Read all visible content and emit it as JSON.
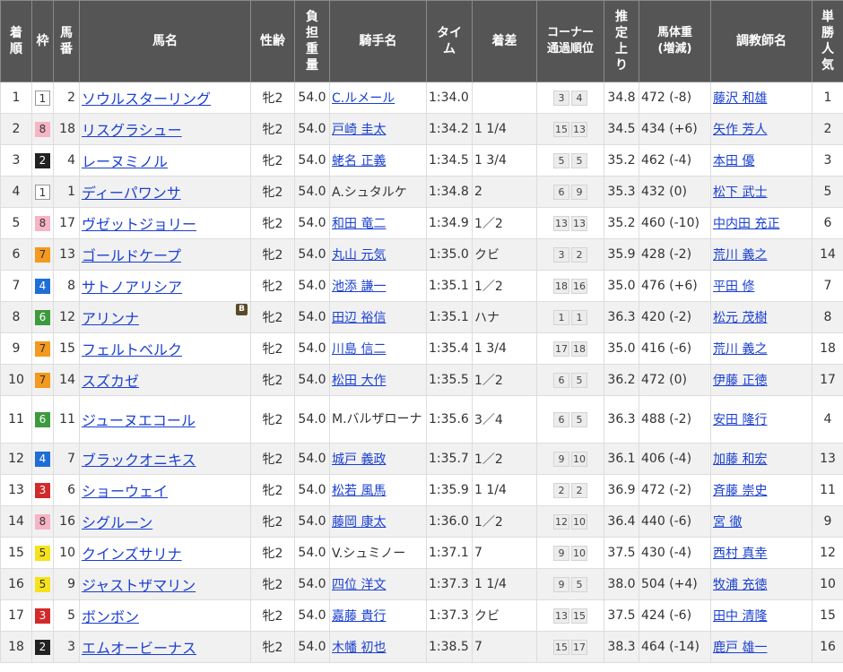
{
  "headers": [
    {
      "key": "rank",
      "label": "着\n順"
    },
    {
      "key": "waku",
      "label": "枠"
    },
    {
      "key": "umaban",
      "label": "馬\n番"
    },
    {
      "key": "horse",
      "label": "馬名"
    },
    {
      "key": "sexage",
      "label": "性齢"
    },
    {
      "key": "weight",
      "label": "負\n担\n重\n量"
    },
    {
      "key": "jockey",
      "label": "騎手名"
    },
    {
      "key": "time",
      "label": "タイ\nム"
    },
    {
      "key": "margin",
      "label": "着差"
    },
    {
      "key": "corner",
      "label": "コーナー\n通過順位"
    },
    {
      "key": "last3f",
      "label": "推\n定\n上\nり"
    },
    {
      "key": "bodyweight",
      "label": "馬体重\n(増減)"
    },
    {
      "key": "trainer",
      "label": "調教師名"
    },
    {
      "key": "pop",
      "label": "単\n勝\n人\n気"
    }
  ],
  "rows": [
    {
      "rank": "1",
      "waku": "1",
      "umaban": "2",
      "horse": "ソウルスターリング",
      "sexage": "牝2",
      "weight": "54.0",
      "jockey": "C.ルメール",
      "jockey_link": true,
      "time": "1:34.0",
      "margin": "",
      "corner": [
        "3",
        "4"
      ],
      "last3f": "34.8",
      "bodyweight": "472 (-8)",
      "trainer": "藤沢 和雄",
      "pop": "1"
    },
    {
      "rank": "2",
      "waku": "8",
      "umaban": "18",
      "horse": "リスグラシュー",
      "sexage": "牝2",
      "weight": "54.0",
      "jockey": "戸崎 圭太",
      "jockey_link": true,
      "time": "1:34.2",
      "margin": "1 1/4",
      "corner": [
        "15",
        "13"
      ],
      "last3f": "34.5",
      "bodyweight": "434 (+6)",
      "trainer": "矢作 芳人",
      "pop": "2"
    },
    {
      "rank": "3",
      "waku": "2",
      "umaban": "4",
      "horse": "レーヌミノル",
      "sexage": "牝2",
      "weight": "54.0",
      "jockey": "蛯名 正義",
      "jockey_link": true,
      "time": "1:34.5",
      "margin": "1 3/4",
      "corner": [
        "5",
        "5"
      ],
      "last3f": "35.2",
      "bodyweight": "462 (-4)",
      "trainer": "本田 優",
      "pop": "3"
    },
    {
      "rank": "4",
      "waku": "1",
      "umaban": "1",
      "horse": "ディーパワンサ",
      "sexage": "牝2",
      "weight": "54.0",
      "jockey": "A.シュタルケ",
      "jockey_link": false,
      "time": "1:34.8",
      "margin": "2",
      "corner": [
        "6",
        "9"
      ],
      "last3f": "35.3",
      "bodyweight": "432 (0)",
      "trainer": "松下 武士",
      "pop": "5"
    },
    {
      "rank": "5",
      "waku": "8",
      "umaban": "17",
      "horse": "ヴゼットジョリー",
      "sexage": "牝2",
      "weight": "54.0",
      "jockey": "和田 竜二",
      "jockey_link": true,
      "time": "1:34.9",
      "margin": "1／2",
      "corner": [
        "13",
        "13"
      ],
      "last3f": "35.2",
      "bodyweight": "460 (-10)",
      "trainer": "中内田 充正",
      "pop": "6"
    },
    {
      "rank": "6",
      "waku": "7",
      "umaban": "13",
      "horse": "ゴールドケープ",
      "sexage": "牝2",
      "weight": "54.0",
      "jockey": "丸山 元気",
      "jockey_link": true,
      "time": "1:35.0",
      "margin": "クビ",
      "corner": [
        "3",
        "2"
      ],
      "last3f": "35.9",
      "bodyweight": "428 (-2)",
      "trainer": "荒川 義之",
      "pop": "14"
    },
    {
      "rank": "7",
      "waku": "4",
      "umaban": "8",
      "horse": "サトノアリシア",
      "sexage": "牝2",
      "weight": "54.0",
      "jockey": "池添 謙一",
      "jockey_link": true,
      "time": "1:35.1",
      "margin": "1／2",
      "corner": [
        "18",
        "16"
      ],
      "last3f": "35.0",
      "bodyweight": "476 (+6)",
      "trainer": "平田 修",
      "pop": "7"
    },
    {
      "rank": "8",
      "waku": "6",
      "umaban": "12",
      "horse": "アリンナ",
      "badge": "B",
      "sexage": "牝2",
      "weight": "54.0",
      "jockey": "田辺 裕信",
      "jockey_link": true,
      "time": "1:35.1",
      "margin": "ハナ",
      "corner": [
        "1",
        "1"
      ],
      "last3f": "36.3",
      "bodyweight": "420 (-2)",
      "trainer": "松元 茂樹",
      "pop": "8"
    },
    {
      "rank": "9",
      "waku": "7",
      "umaban": "15",
      "horse": "フェルトベルク",
      "sexage": "牝2",
      "weight": "54.0",
      "jockey": "川島 信二",
      "jockey_link": true,
      "time": "1:35.4",
      "margin": "1 3/4",
      "corner": [
        "17",
        "18"
      ],
      "last3f": "35.0",
      "bodyweight": "416 (-6)",
      "trainer": "荒川 義之",
      "pop": "18"
    },
    {
      "rank": "10",
      "waku": "7",
      "umaban": "14",
      "horse": "スズカゼ",
      "sexage": "牝2",
      "weight": "54.0",
      "jockey": "松田 大作",
      "jockey_link": true,
      "time": "1:35.5",
      "margin": "1／2",
      "corner": [
        "6",
        "5"
      ],
      "last3f": "36.2",
      "bodyweight": "472 (0)",
      "trainer": "伊藤 正徳",
      "pop": "17"
    },
    {
      "rank": "11",
      "waku": "6",
      "umaban": "11",
      "horse": "ジューヌエコール",
      "sexage": "牝2",
      "weight": "54.0",
      "jockey": "M.バルザローナ",
      "jockey_link": false,
      "tall": true,
      "time": "1:35.6",
      "margin": "3／4",
      "corner": [
        "6",
        "5"
      ],
      "last3f": "36.3",
      "bodyweight": "488 (-2)",
      "trainer": "安田 隆行",
      "pop": "4"
    },
    {
      "rank": "12",
      "waku": "4",
      "umaban": "7",
      "horse": "ブラックオニキス",
      "sexage": "牝2",
      "weight": "54.0",
      "jockey": "城戸 義政",
      "jockey_link": true,
      "time": "1:35.7",
      "margin": "1／2",
      "corner": [
        "9",
        "10"
      ],
      "last3f": "36.1",
      "bodyweight": "406 (-4)",
      "trainer": "加藤 和宏",
      "pop": "13"
    },
    {
      "rank": "13",
      "waku": "3",
      "umaban": "6",
      "horse": "ショーウェイ",
      "sexage": "牝2",
      "weight": "54.0",
      "jockey": "松若 風馬",
      "jockey_link": true,
      "time": "1:35.9",
      "margin": "1 1/4",
      "corner": [
        "2",
        "2"
      ],
      "last3f": "36.9",
      "bodyweight": "472 (-2)",
      "trainer": "斉藤 崇史",
      "pop": "11"
    },
    {
      "rank": "14",
      "waku": "8",
      "umaban": "16",
      "horse": "シグルーン",
      "sexage": "牝2",
      "weight": "54.0",
      "jockey": "藤岡 康太",
      "jockey_link": true,
      "time": "1:36.0",
      "margin": "1／2",
      "corner": [
        "12",
        "10"
      ],
      "last3f": "36.4",
      "bodyweight": "440 (-6)",
      "trainer": "宮 徹",
      "pop": "9"
    },
    {
      "rank": "15",
      "waku": "5",
      "umaban": "10",
      "horse": "クインズサリナ",
      "sexage": "牝2",
      "weight": "54.0",
      "jockey": "V.シュミノー",
      "jockey_link": false,
      "time": "1:37.1",
      "margin": "7",
      "corner": [
        "9",
        "10"
      ],
      "last3f": "37.5",
      "bodyweight": "430 (-4)",
      "trainer": "西村 真幸",
      "pop": "12"
    },
    {
      "rank": "16",
      "waku": "5",
      "umaban": "9",
      "horse": "ジャストザマリン",
      "sexage": "牝2",
      "weight": "54.0",
      "jockey": "四位 洋文",
      "jockey_link": true,
      "time": "1:37.3",
      "margin": "1 1/4",
      "corner": [
        "9",
        "5"
      ],
      "last3f": "38.0",
      "bodyweight": "504 (+4)",
      "trainer": "牧浦 充徳",
      "pop": "10"
    },
    {
      "rank": "17",
      "waku": "3",
      "umaban": "5",
      "horse": "ボンボン",
      "sexage": "牝2",
      "weight": "54.0",
      "jockey": "嘉藤 貴行",
      "jockey_link": true,
      "time": "1:37.3",
      "margin": "クビ",
      "corner": [
        "13",
        "15"
      ],
      "last3f": "37.5",
      "bodyweight": "424 (-6)",
      "trainer": "田中 清隆",
      "pop": "15"
    },
    {
      "rank": "18",
      "waku": "2",
      "umaban": "3",
      "horse": "エムオービーナス",
      "sexage": "牝2",
      "weight": "54.0",
      "jockey": "木幡 初也",
      "jockey_link": true,
      "time": "1:38.5",
      "margin": "7",
      "corner": [
        "15",
        "17"
      ],
      "last3f": "38.3",
      "bodyweight": "464 (-14)",
      "trainer": "鹿戸 雄一",
      "pop": "16"
    }
  ]
}
